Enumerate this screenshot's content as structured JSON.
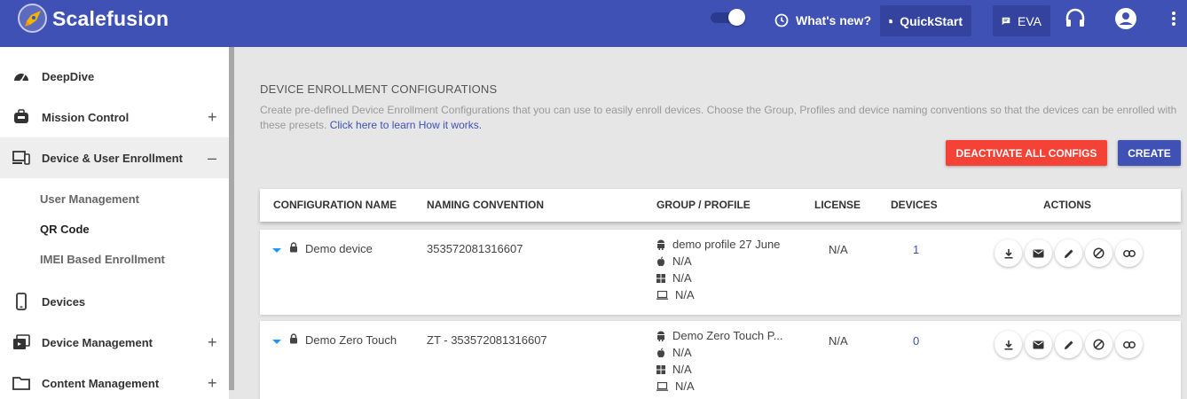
{
  "header": {
    "brand": "Scalefusion",
    "whats_new": "What's new?",
    "quickstart": "QuickStart",
    "eva": "EVA"
  },
  "sidebar": {
    "items": [
      {
        "label": "DeepDive",
        "icon": "speedometer-icon",
        "toggle": ""
      },
      {
        "label": "Mission Control",
        "icon": "control-icon",
        "toggle": "+"
      },
      {
        "label": "Device & User Enrollment",
        "icon": "devices-icon",
        "toggle": "–"
      },
      {
        "label": "Devices",
        "icon": "phone-icon",
        "toggle": ""
      },
      {
        "label": "Device Management",
        "icon": "device-management-icon",
        "toggle": "+"
      },
      {
        "label": "Content Management",
        "icon": "folder-icon",
        "toggle": "+"
      }
    ],
    "subitems": [
      {
        "label": "User Management"
      },
      {
        "label": "QR Code"
      },
      {
        "label": "IMEI Based Enrollment"
      }
    ]
  },
  "main": {
    "heading": "DEVICE ENROLLMENT CONFIGURATIONS",
    "description": "Create pre-defined Device Enrollment Configurations that you can use to easily enroll devices. Choose the Group, Profiles and device naming conventions so that the devices can be enrolled with these presets.",
    "learn_link": "Click here to learn How it works.",
    "deactivate_label": "DEACTIVATE ALL CONFIGS",
    "create_label": "CREATE"
  },
  "table": {
    "columns": [
      "CONFIGURATION NAME",
      "NAMING CONVENTION",
      "GROUP / PROFILE",
      "LICENSE",
      "DEVICES",
      "ACTIONS"
    ],
    "rows": [
      {
        "name": "Demo device",
        "naming": "353572081316607",
        "profiles": {
          "android": "demo profile 27 June",
          "apple": "N/A",
          "windows": "N/A",
          "laptop": "N/A"
        },
        "license": "N/A",
        "devices": "1"
      },
      {
        "name": "Demo Zero Touch",
        "naming": "ZT - 353572081316607",
        "profiles": {
          "android": "Demo Zero Touch P...",
          "apple": "N/A",
          "windows": "N/A",
          "laptop": "N/A"
        },
        "license": "N/A",
        "devices": "0"
      }
    ],
    "action_icons": [
      "download-icon",
      "mail-icon",
      "edit-icon",
      "block-icon",
      "link-icon"
    ]
  },
  "colors": {
    "topbar": "#3f51b5",
    "danger": "#f44336",
    "primary": "#3f51b5"
  }
}
